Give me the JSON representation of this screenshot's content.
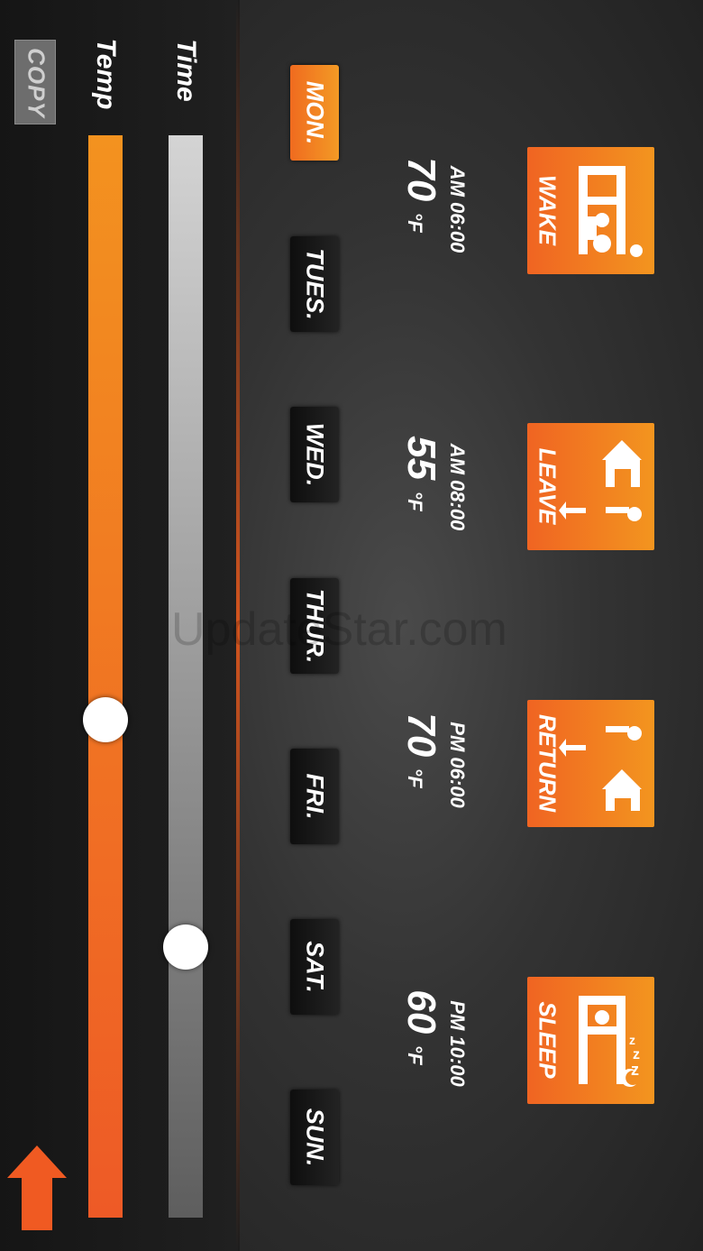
{
  "sidebar": {
    "copy_label": "COPY",
    "temp_label": "Temp",
    "time_label": "Time",
    "temp_slider_position": 0.54,
    "time_slider_position": 0.75
  },
  "days": [
    {
      "label": "MON.",
      "active": true
    },
    {
      "label": "TUES.",
      "active": false
    },
    {
      "label": "WED.",
      "active": false
    },
    {
      "label": "THUR.",
      "active": false
    },
    {
      "label": "FRI.",
      "active": false
    },
    {
      "label": "SAT.",
      "active": false
    },
    {
      "label": "SUN.",
      "active": false
    }
  ],
  "events": [
    {
      "name": "WAKE",
      "time": "AM 06:00",
      "temp": "70",
      "unit": "°F",
      "icon": "wake-icon"
    },
    {
      "name": "LEAVE",
      "time": "AM 08:00",
      "temp": "55",
      "unit": "°F",
      "icon": "leave-icon"
    },
    {
      "name": "RETURN",
      "time": "PM 06:00",
      "temp": "70",
      "unit": "°F",
      "icon": "return-icon"
    },
    {
      "name": "SLEEP",
      "time": "PM 10:00",
      "temp": "60",
      "unit": "°F",
      "icon": "sleep-icon"
    }
  ],
  "watermark": "UpdateStar.com",
  "colors": {
    "accent": "#f06a22",
    "accent_light": "#f3951f"
  }
}
